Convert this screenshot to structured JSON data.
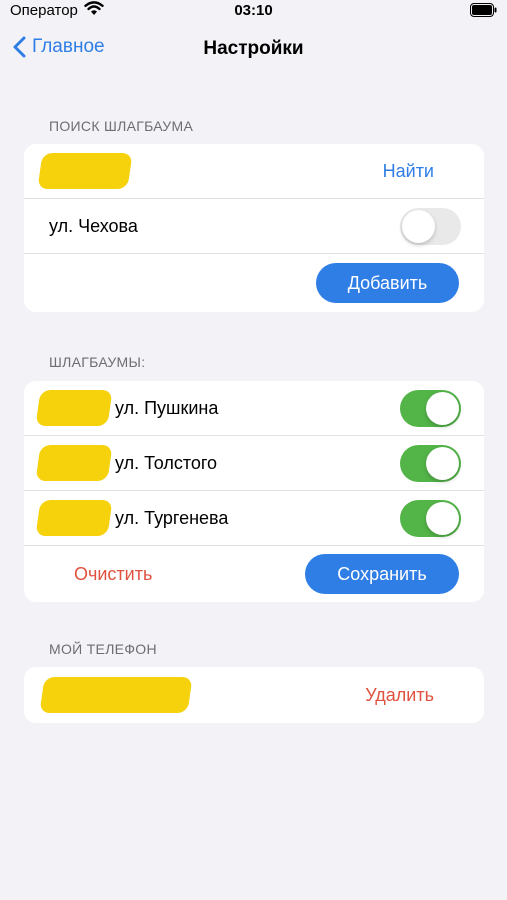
{
  "status_bar": {
    "carrier": "Оператор",
    "time": "03:10"
  },
  "nav": {
    "back_label": "Главное",
    "title": "Настройки"
  },
  "search_section": {
    "header": "ПОИСК ШЛАГБАУМА",
    "find_label": "Найти",
    "street": "ул. Чехова",
    "street_toggle_on": false,
    "add_label": "Добавить"
  },
  "barriers_section": {
    "header": "ШЛАГБАУМЫ:",
    "items": [
      {
        "name": "ул. Пушкина",
        "enabled": true
      },
      {
        "name": "ул. Толстого",
        "enabled": true
      },
      {
        "name": "ул. Тургенева",
        "enabled": true
      }
    ],
    "clear_label": "Очистить",
    "save_label": "Сохранить"
  },
  "phone_section": {
    "header": "МОЙ ТЕЛЕФОН",
    "delete_label": "Удалить"
  },
  "colors": {
    "accent": "#2f7ee6",
    "destructive": "#e0513f",
    "toggle_on": "#53b448",
    "redaction": "#f5d000"
  }
}
